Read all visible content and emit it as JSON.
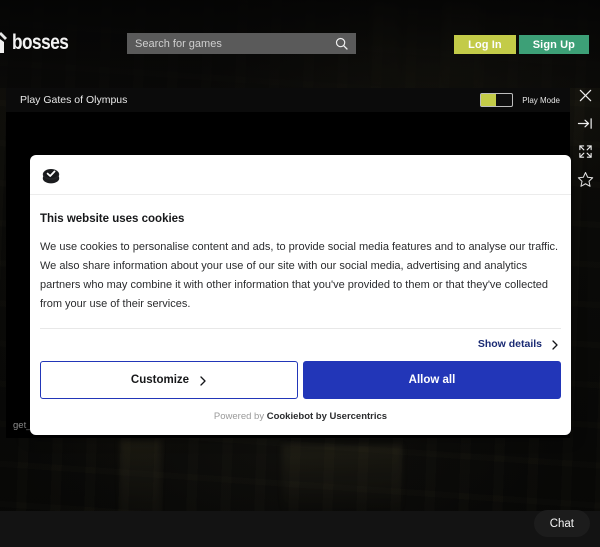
{
  "header": {
    "brand_text": "bosses",
    "brand_icon": "castle-mark-icon",
    "search": {
      "placeholder": "Search for games",
      "value": "",
      "icon": "search-icon"
    },
    "login_label": "Log In",
    "signup_label": "Sign Up",
    "login_color": "#c3cb48",
    "signup_color": "#3da077"
  },
  "game_panel": {
    "title": "Play Gates of Olympus",
    "play_mode_label": "Play Mode",
    "play_mode_on": false,
    "toggle_color": "#c3cb48",
    "error_message": "get_game_link_system_error"
  },
  "icon_rail": {
    "close_label": "close-icon",
    "collapse_label": "collapse-panel-icon",
    "fullscreen_label": "fullscreen-icon",
    "favorite_label": "star-icon"
  },
  "cookie_dialog": {
    "logo_icon": "cookiebot-logo-icon",
    "heading": "This website uses cookies",
    "body": "We use cookies to personalise content and ads, to provide social media features and to analyse our traffic. We also share information about your use of our site with our social media, advertising and analytics partners who may combine it with other information that you've provided to them or that they've collected from your use of their services.",
    "show_details_label": "Show details",
    "customize_label": "Customize",
    "allow_all_label": "Allow all",
    "accent_color": "#2236b8",
    "link_color": "#1a2a73",
    "footer_prefix": "Powered by ",
    "footer_brand": "Cookiebot by Usercentrics"
  },
  "footer": {
    "chat_label": "Chat"
  }
}
